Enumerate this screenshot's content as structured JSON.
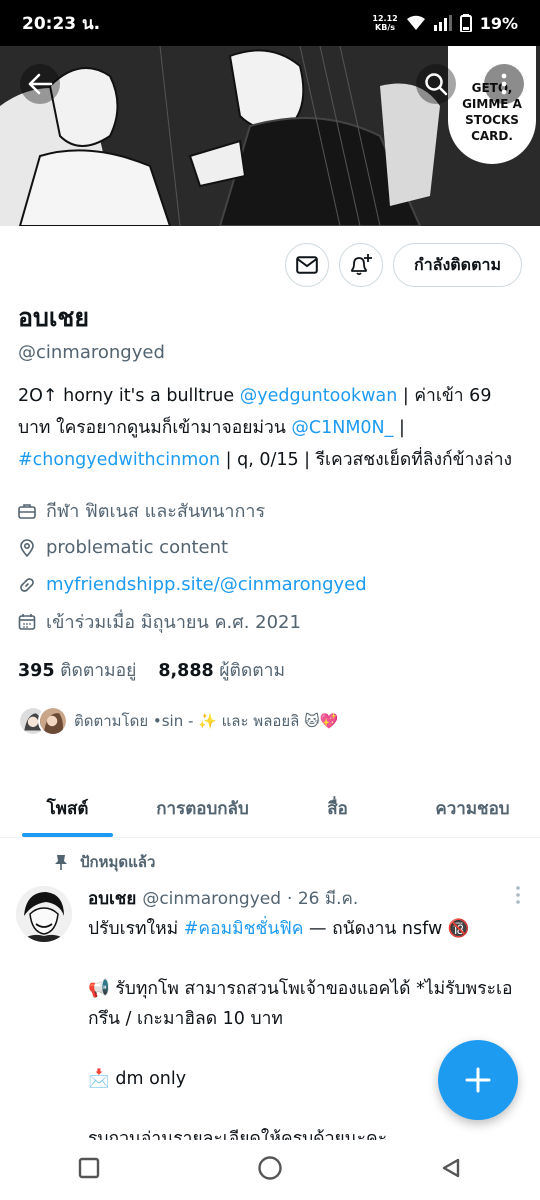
{
  "status": {
    "time": "20:23 น.",
    "net_speed_top": "12.12",
    "net_speed_bottom": "KB/s",
    "battery": "19%"
  },
  "banner": {
    "speech_bubble": "GETO, GIMME A STOCKS CARD."
  },
  "actions": {
    "following_label": "กำลังติดตาม"
  },
  "profile": {
    "name": "อบเชย",
    "handle": "@cinmarongyed",
    "bio": {
      "part1": "2O↑ horny it's a bulltrue ",
      "mention1": "@yedguntookwan",
      "part2": " | ค่าเข้า 69 บาท ใครอยากดูนมก็เข้ามาจอยม่วน ",
      "mention2": "@C1NM0N_",
      "part3": " | ",
      "hashtag": "#chongyedwithcinmon",
      "part4": " | q, 0/15 | รีเควสชงเย็ดที่ลิงก์ข้างล่าง"
    },
    "category": "กีฬา ฟิตเนส และสันทนาการ",
    "location": "problematic content",
    "url": "myfriendshipp.site/@cinmarongyed",
    "joined": "เข้าร่วมเมื่อ มิถุนายน ค.ศ. 2021",
    "following_count": "395",
    "following_label": "ติดตามอยู่",
    "followers_count": "8,888",
    "followers_label": "ผู้ติดตาม",
    "followed_by": "ติดตามโดย •sin - ✨ และ พลอยลิ 🐱💖"
  },
  "tabs": [
    "โพสต์",
    "การตอบกลับ",
    "สื่อ",
    "ความชอบ"
  ],
  "tweet": {
    "pinned_label": "ปักหมุดแล้ว",
    "name": "อบเชย",
    "handle": "@cinmarongyed",
    "date": "· 26 มี.ค.",
    "line1_pre": "ปรับเรทใหม่ ",
    "line1_tag": "#คอมมิชชั่นฟิค",
    "line1_post": " — ถนัดงาน nsfw 🔞",
    "line2": "📢 รับทุกโพ สามารถสวนโพเจ้าของแอคได้ *ไม่รับพระเอกรึน / เกะมาฮิลด 10 บาท",
    "line3": "📩 dm only",
    "line4": "รบกวนอ่านรายละเอียดให้ครบด้วยนะคะ"
  },
  "colors": {
    "accent": "#1d9bf0",
    "text": "#0f1419",
    "secondary": "#536471"
  }
}
